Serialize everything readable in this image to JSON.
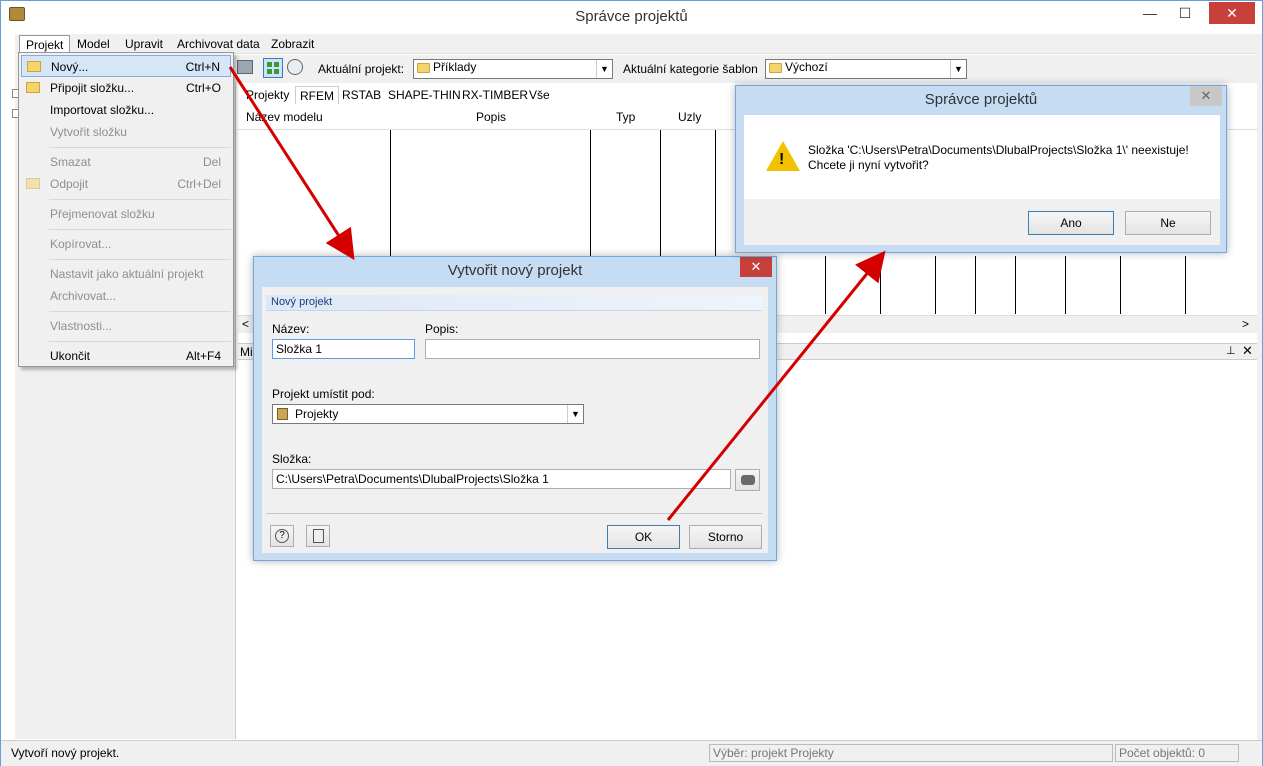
{
  "window": {
    "title": "Správce projektů",
    "min": "—",
    "max": "☐",
    "close": "✕"
  },
  "menubar": [
    "Projekt",
    "Model",
    "Upravit",
    "Archivovat data",
    "Zobrazit"
  ],
  "toolbar": {
    "current_project_label": "Aktuální projekt:",
    "current_project_value": "Příklady",
    "template_category_label": "Aktuální kategorie šablon",
    "template_category_value": "Výchozí"
  },
  "tabs": [
    "Projekty",
    "RFEM",
    "RSTAB",
    "SHAPE-THIN",
    "RX-TIMBER",
    "Vše"
  ],
  "grid_headers": {
    "name": "Název modelu",
    "desc": "Popis",
    "type": "Typ",
    "nodes": "Uzly"
  },
  "dropdown": {
    "items": [
      {
        "label": "Nový...",
        "shortcut": "Ctrl+N"
      },
      {
        "label": "Připojit složku...",
        "shortcut": "Ctrl+O"
      },
      {
        "label": "Importovat složku...",
        "shortcut": ""
      },
      {
        "label": "Vytvořit složku",
        "shortcut": ""
      },
      {
        "label": "Smazat",
        "shortcut": "Del"
      },
      {
        "label": "Odpojit",
        "shortcut": "Ctrl+Del"
      },
      {
        "label": "Přejmenovat složku",
        "shortcut": ""
      },
      {
        "label": "Kopírovat...",
        "shortcut": ""
      },
      {
        "label": "Nastavit jako aktuální projekt",
        "shortcut": ""
      },
      {
        "label": "Archivovat...",
        "shortcut": ""
      },
      {
        "label": "Vlastnosti...",
        "shortcut": ""
      },
      {
        "label": "Ukončit",
        "shortcut": "Alt+F4"
      }
    ]
  },
  "new_project_dialog": {
    "title": "Vytvořit nový projekt",
    "group_title": "Nový projekt",
    "name_label": "Název:",
    "name_value": "Složka 1",
    "desc_label": "Popis:",
    "desc_value": "",
    "parent_label": "Projekt umístit pod:",
    "parent_value": "Projekty",
    "folder_label": "Složka:",
    "folder_value": "C:\\Users\\Petra\\Documents\\DlubalProjects\\Složka 1",
    "ok": "OK",
    "cancel": "Storno"
  },
  "confirm_dialog": {
    "title": "Správce projektů",
    "message_line1": "Složka 'C:\\Users\\Petra\\Documents\\DlubalProjects\\Složka 1\\' neexistuje!",
    "message_line2": "Chcete ji nyní vytvořit?",
    "yes": "Ano",
    "no": "Ne"
  },
  "bottom_pane_label": "Mi",
  "status": {
    "left": "Vytvoří nový projekt.",
    "selection": "Výběr: projekt Projekty",
    "count": "Počet objektů: 0"
  },
  "colors": {
    "arrow": "#d40000",
    "accent": "#70a7dd",
    "close": "#c7403a"
  }
}
